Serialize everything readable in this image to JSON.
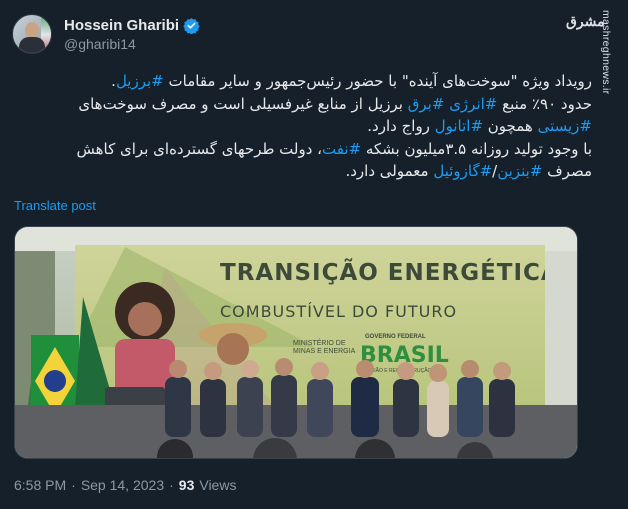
{
  "author": {
    "display_name": "Hossein Gharibi",
    "handle": "@gharibi14",
    "verified_icon": "verified-badge-icon"
  },
  "watermark": {
    "logo_text": "مشرق",
    "site": "mashreghnews.ir"
  },
  "tweet": {
    "lines": [
      [
        {
          "t": "رویداد ویژه \"سوخت‌های آینده\" با حضور رئیس‌جمهور و سایر مقامات ",
          "h": false
        },
        {
          "t": "#برزیل",
          "h": true
        },
        {
          "t": ".",
          "h": false
        }
      ],
      [
        {
          "t": "حدود ۹۰٪ منبع ",
          "h": false
        },
        {
          "t": "#انرژی",
          "h": true
        },
        {
          "t": " ",
          "h": false
        },
        {
          "t": "#برق",
          "h": true
        },
        {
          "t": " برزیل از منابع غیرفسیلی است و مصرف سوخت‌های",
          "h": false
        }
      ],
      [
        {
          "t": "#زیستی",
          "h": true
        },
        {
          "t": " همچون ",
          "h": false
        },
        {
          "t": "#اتانول",
          "h": true
        },
        {
          "t": " رواج دارد.",
          "h": false
        }
      ],
      [
        {
          "t": "با وجود تولید روزانه ۳.۵میلیون بشکه ",
          "h": false
        },
        {
          "t": "#نفت",
          "h": true
        },
        {
          "t": "، دولت طرحهای گسترده‌ای برای کاهش",
          "h": false
        }
      ],
      [
        {
          "t": "مصرف ",
          "h": false
        },
        {
          "t": "#بنزین",
          "h": true
        },
        {
          "t": "/",
          "h": false
        },
        {
          "t": "#گازوئیل",
          "h": true
        },
        {
          "t": " معمولی دارد.",
          "h": false
        }
      ]
    ],
    "translate_label": "Translate post"
  },
  "media": {
    "banner_title": "TRANSIÇÃO ENERGÉTICA",
    "banner_subtitle": "COMBUSTÍVEL DO FUTURO",
    "ministry_line1": "MINISTÉRIO DE",
    "ministry_line2": "MINAS E ENERGIA",
    "gov_label": "GOVERNO FEDERAL",
    "gov_word": "BRASIL",
    "gov_tagline": "UNIÃO E RECONSTRUÇÃO"
  },
  "meta": {
    "time": "6:58 PM",
    "separator": "·",
    "date": "Sep 14, 2023",
    "views_count": "93",
    "views_label": "Views"
  },
  "colors": {
    "background": "#15202b",
    "link": "#1d9bf0",
    "text": "#e7e9ea",
    "muted": "#8b98a5"
  }
}
